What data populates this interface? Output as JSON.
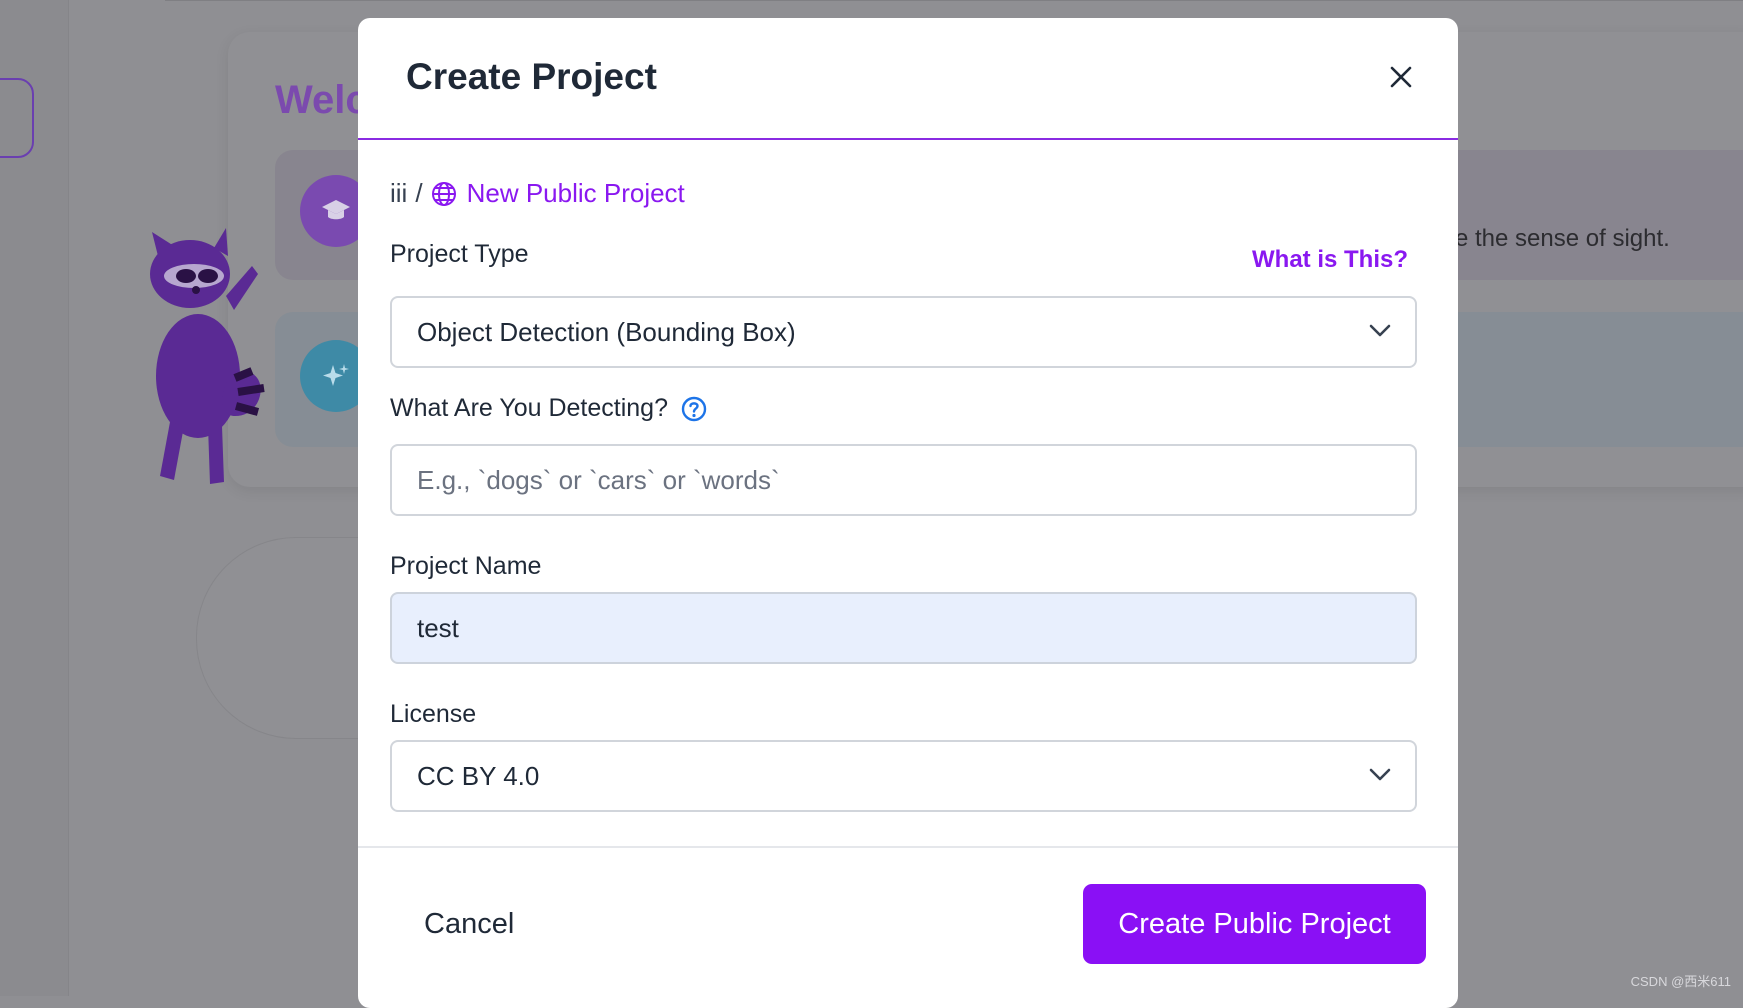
{
  "background": {
    "welcome_text": "Welc",
    "sight_text": "e the sense of sight."
  },
  "modal": {
    "title": "Create Project",
    "breadcrumb": {
      "workspace": "iii",
      "separator": "/",
      "current": "New Public Project"
    },
    "project_type": {
      "label": "Project Type",
      "help_link": "What is This?",
      "value": "Object Detection (Bounding Box)"
    },
    "detecting": {
      "label": "What Are You Detecting?",
      "placeholder": "E.g., `dogs` or `cars` or `words`"
    },
    "project_name": {
      "label": "Project Name",
      "value": "test"
    },
    "license": {
      "label": "License",
      "value": "CC BY 4.0"
    },
    "cancel_label": "Cancel",
    "submit_label": "Create Public Project"
  },
  "watermark": "CSDN @西米611",
  "colors": {
    "accent": "#8a10f5",
    "link": "#8a18f0",
    "help_icon": "#1d74e8",
    "filled_input": "#e8effd"
  },
  "icons": [
    "close-icon",
    "globe-icon",
    "help-icon",
    "chevron-down-icon",
    "graduation-cap-icon",
    "sparkle-icon"
  ]
}
